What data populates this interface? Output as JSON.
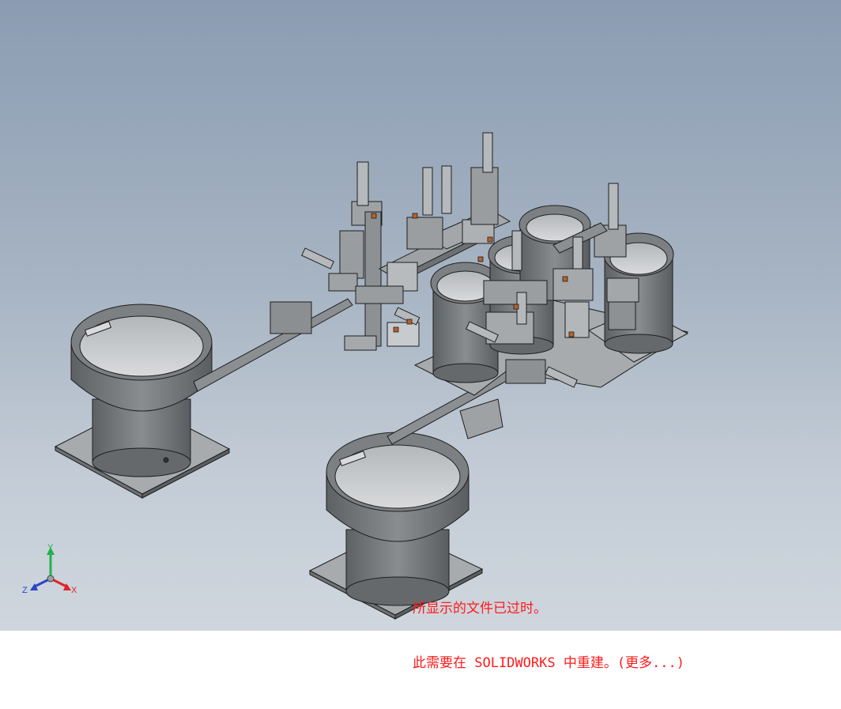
{
  "viewport": {
    "notice_line1": "所显示的文件已过时。",
    "notice_line2": "此需要在 SOLIDWORKS 中重建。(更多...)",
    "notice_color": "#ff1a1a"
  },
  "triad": {
    "x_label": "X",
    "y_label": "Y",
    "z_label": "Z",
    "x_color": "#e0242a",
    "y_color": "#22b14c",
    "z_color": "#2a46c8"
  },
  "model": {
    "part_color": "#7a7d80",
    "edge_color": "#1e1e1e"
  }
}
